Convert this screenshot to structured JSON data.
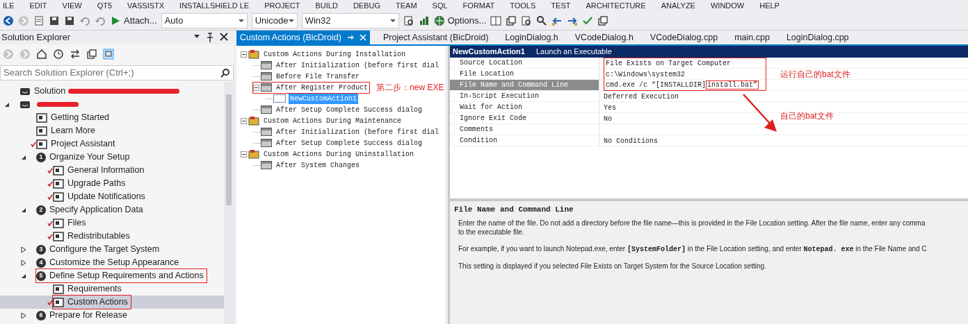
{
  "menu_bar": {
    "items": [
      "ILE",
      "EDIT",
      "VIEW",
      "QT5",
      "VASSISTX",
      "INSTALLSHIELD LE",
      "PROJECT",
      "BUILD",
      "DEBUG",
      "TEAM",
      "SQL",
      "FORMAT",
      "TOOLS",
      "TEST",
      "ARCHITECTURE",
      "ANALYZE",
      "WINDOW",
      "HELP"
    ]
  },
  "toolbar": {
    "run_label": "Attach...",
    "combos": [
      {
        "value": "Auto"
      },
      {
        "value": "Unicode"
      },
      {
        "value": "Win32"
      }
    ],
    "options_label": "Options..."
  },
  "solution_explorer": {
    "title": "Solution Explorer",
    "search": {
      "placeholder": "Search Solution Explorer (Ctrl+;)"
    },
    "tree": [
      {
        "label": "Solution",
        "redacted": true,
        "selected": false
      },
      {
        "redacted": true,
        "expanded": true,
        "selected": false,
        "children": [
          {
            "label": "Getting Started",
            "checked": false,
            "selected": false
          },
          {
            "label": "Learn More",
            "checked": false,
            "selected": false
          },
          {
            "label": "Project Assistant",
            "checked": true,
            "selected": false
          },
          {
            "label": "Organize Your Setup",
            "step": "1",
            "expanded": true,
            "selected": false,
            "children": [
              {
                "label": "General Information",
                "checked": true,
                "selected": false
              },
              {
                "label": "Upgrade Paths",
                "checked": true,
                "selected": false
              },
              {
                "label": "Update Notifications",
                "checked": true,
                "selected": false
              }
            ]
          },
          {
            "label": "Specify Application Data",
            "step": "2",
            "expanded": true,
            "selected": false,
            "children": [
              {
                "label": "Files",
                "checked": true,
                "selected": false
              },
              {
                "label": "Redistributables",
                "checked": true,
                "selected": false
              }
            ]
          },
          {
            "label": "Configure the Target System",
            "step": "3",
            "expanded": false,
            "selected": false
          },
          {
            "label": "Customize the Setup Appearance",
            "step": "4",
            "expanded": false,
            "selected": false
          },
          {
            "label": "Define Setup Requirements and Actions",
            "step": "5",
            "expanded": true,
            "highlighted": true,
            "selected": false,
            "children": [
              {
                "label": "Requirements",
                "checked": false,
                "selected": false
              },
              {
                "label": "Custom Actions",
                "checked": true,
                "highlighted": true,
                "selected": true
              }
            ]
          },
          {
            "label": "Prepare for Release",
            "step": "6",
            "expanded": false,
            "selected": false
          }
        ]
      }
    ]
  },
  "tabs": [
    {
      "label": "Custom Actions (BicDroid)",
      "selected": true
    },
    {
      "label": "Project Assistant (BicDroid)",
      "selected": false
    },
    {
      "label": "LoginDialog.h",
      "selected": false
    },
    {
      "label": "VCodeDialog.h",
      "selected": false
    },
    {
      "label": "VCodeDialog.cpp",
      "selected": false
    },
    {
      "label": "main.cpp",
      "selected": false
    },
    {
      "label": "LoginDialog.cpp",
      "selected": false
    }
  ],
  "action_tree": [
    {
      "label": "Custom Actions During Installation",
      "expanded": true,
      "selected": false,
      "children": [
        {
          "label": "After Initialization (before first dial",
          "selected": false
        },
        {
          "label": "Before File Transfer",
          "selected": false
        },
        {
          "label": "After Register Product",
          "expanded": true,
          "highlighted": true,
          "note": "第二步：new EXE",
          "selected": false,
          "children": [
            {
              "label": "NewCustomAction1",
              "selected": true
            }
          ]
        },
        {
          "label": "After Setup Complete Success dialog",
          "selected": false
        }
      ]
    },
    {
      "label": "Custom Actions During Maintenance",
      "expanded": true,
      "selected": false,
      "children": [
        {
          "label": "After Initialization (before first dial",
          "selected": false
        },
        {
          "label": "After Setup Complete Success dialog",
          "selected": false
        }
      ]
    },
    {
      "label": "Custom Actions During Uninstallation",
      "expanded": true,
      "selected": false,
      "children": [
        {
          "label": "After System Changes",
          "selected": false
        }
      ]
    }
  ],
  "properties": {
    "name": "NewCustomAction1",
    "description": "Launch an Executable",
    "rows": [
      {
        "name": "Source Location",
        "value": "File Exists on Target Computer",
        "annotated": true,
        "selected": false
      },
      {
        "name": "File Location",
        "value": "c:\\Windows\\system32",
        "annotated": true,
        "selected": false
      },
      {
        "name": "File Name and Command Line",
        "value": "cmd.exe /c “[INSTALLDIR]",
        "value_boxed": "install.bat”",
        "annotated": true,
        "selected": true
      },
      {
        "name": "In-Script Execution",
        "value": "Deferred Execution",
        "annotated": false,
        "selected": false
      },
      {
        "name": "Wait for Action",
        "value": "Yes",
        "annotated": false,
        "selected": false
      },
      {
        "name": "Ignore Exit Code",
        "value": "No",
        "annotated": false,
        "selected": false
      },
      {
        "name": "Comments",
        "annotated": false,
        "selected": false
      },
      {
        "name": "Condition",
        "value": "No Conditions",
        "annotated": false,
        "selected": false
      }
    ],
    "notes": [
      {
        "text": "运行自己的bat文件"
      },
      {
        "text": "自己的bat文件",
        "arrow": true
      }
    ]
  },
  "help": {
    "title": "File Name and Command Line",
    "paragraphs": [
      {
        "lines": [
          "Enter the name of the file. Do not add a directory before the file name—this is provided in the File Location setting. After the file name, enter any comma",
          "to the executable file."
        ]
      },
      {
        "lines": [
          "For example, if you want to launch Notepad.exe, enter **[SystemFolder]** in the File Location setting, and enter **Notepad. exe** in the File Name and C"
        ]
      },
      {
        "lines": [
          "This setting is displayed if you selected File Exists on Target System for the Source Location setting."
        ]
      }
    ]
  }
}
